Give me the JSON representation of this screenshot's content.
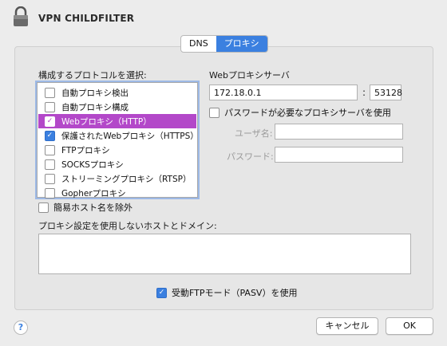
{
  "window": {
    "title": "VPN CHILDFILTER"
  },
  "tabs": [
    {
      "label": "DNS",
      "active": false
    },
    {
      "label": "プロキシ",
      "active": true
    }
  ],
  "protocols": {
    "label": "構成するプロトコルを選択:",
    "items": [
      {
        "label": "自動プロキシ検出",
        "checked": false,
        "selected": false
      },
      {
        "label": "自動プロキシ構成",
        "checked": false,
        "selected": false
      },
      {
        "label": "Webプロキシ（HTTP）",
        "checked": true,
        "selected": true
      },
      {
        "label": "保護されたWebプロキシ（HTTPS）",
        "checked": true,
        "selected": false
      },
      {
        "label": "FTPプロキシ",
        "checked": false,
        "selected": false
      },
      {
        "label": "SOCKSプロキシ",
        "checked": false,
        "selected": false
      },
      {
        "label": "ストリーミングプロキシ（RTSP）",
        "checked": false,
        "selected": false
      },
      {
        "label": "Gopherプロキシ",
        "checked": false,
        "selected": false
      }
    ]
  },
  "proxy_server": {
    "label": "Webプロキシサーバ",
    "host": "172.18.0.1",
    "colon": ":",
    "port": "53128",
    "password_required": {
      "label": "パスワードが必要なプロキシサーバを使用",
      "checked": false
    },
    "username_label": "ユーザ名:",
    "username_value": "",
    "password_label": "パスワード:",
    "password_value": ""
  },
  "exclude_simple_hosts": {
    "label": "簡易ホスト名を除外",
    "checked": false
  },
  "bypass": {
    "label": "プロキシ設定を使用しないホストとドメイン:",
    "value": ""
  },
  "pasv": {
    "label": "受動FTPモード（PASV）を使用",
    "checked": true
  },
  "footer": {
    "help": "?",
    "cancel_label": "キャンセル",
    "ok_label": "OK"
  },
  "icons": {
    "lock": "lock-icon",
    "check": "✓"
  },
  "colors": {
    "accent": "#3b80e0",
    "selection": "#b348c9"
  }
}
